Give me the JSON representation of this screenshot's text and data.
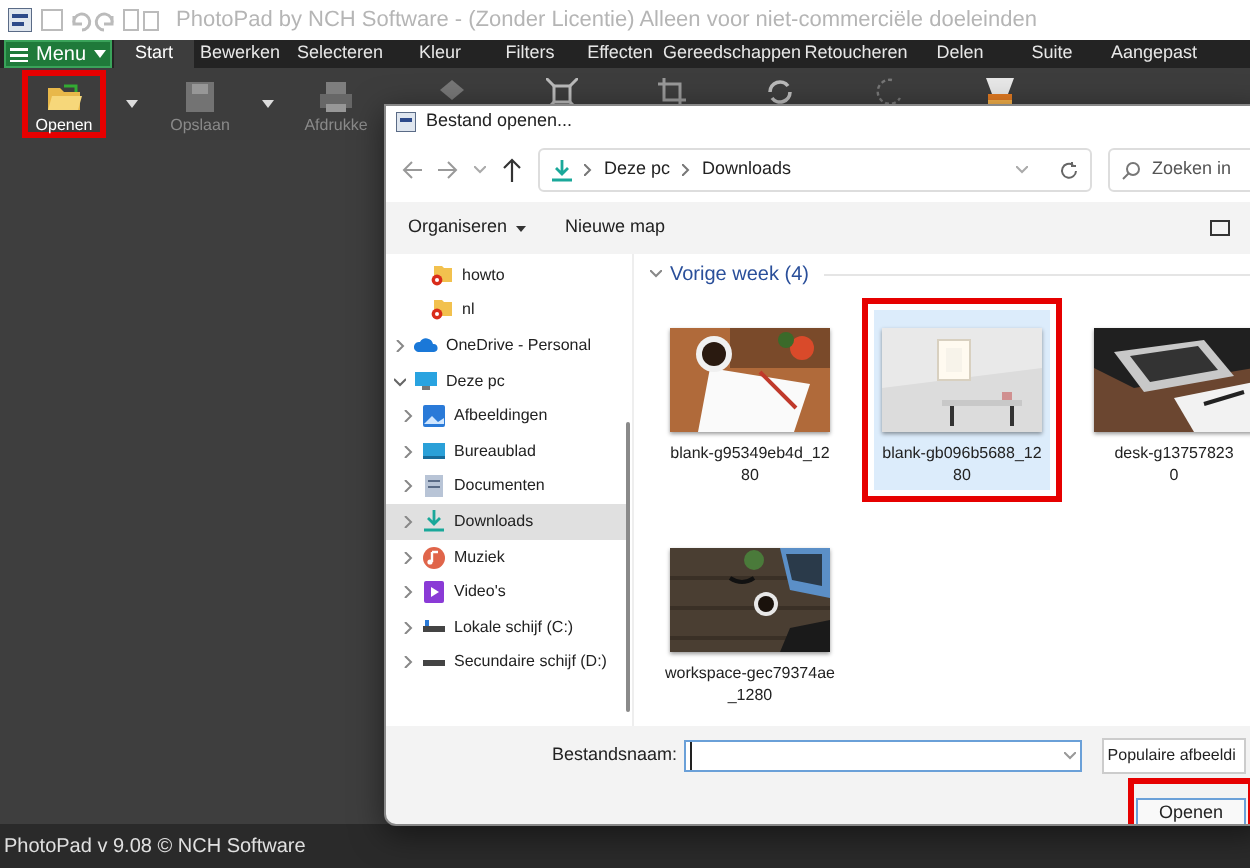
{
  "window": {
    "title": "PhotoPad by NCH Software - (Zonder Licentie) Alleen voor niet-commerciële doeleinden"
  },
  "menu_button": {
    "label": "Menu"
  },
  "tabs": [
    {
      "label": "Start",
      "selected": true
    },
    {
      "label": "Bewerken",
      "selected": false
    },
    {
      "label": "Selecteren",
      "selected": false
    },
    {
      "label": "Kleur",
      "selected": false
    },
    {
      "label": "Filters",
      "selected": false
    },
    {
      "label": "Effecten",
      "selected": false
    },
    {
      "label": "Gereedschappen",
      "selected": false
    },
    {
      "label": "Retoucheren",
      "selected": false
    },
    {
      "label": "Delen",
      "selected": false
    },
    {
      "label": "Suite",
      "selected": false
    },
    {
      "label": "Aangepast",
      "selected": false
    }
  ],
  "toolbar": [
    {
      "kind": "button",
      "label": "Openen",
      "disabled": false,
      "highlighted": true
    },
    {
      "kind": "caret"
    },
    {
      "kind": "button",
      "label": "Opslaan",
      "disabled": true,
      "highlighted": false
    },
    {
      "kind": "caret"
    },
    {
      "kind": "button",
      "label": "Afdrukke",
      "disabled": true,
      "highlighted": false
    }
  ],
  "dialog": {
    "title": "Bestand openen...",
    "path": [
      "Deze pc",
      "Downloads"
    ],
    "search": {
      "placeholder": "Zoeken in"
    },
    "commands": [
      {
        "label": "Organiseren",
        "dropdown": true
      },
      {
        "label": "Nieuwe map",
        "dropdown": false
      }
    ],
    "nav": [
      {
        "label": "howto",
        "selected": false
      },
      {
        "label": "nl",
        "selected": false
      },
      {
        "label": "OneDrive - Personal",
        "selected": false,
        "expanded": false
      },
      {
        "label": "Deze pc",
        "selected": false,
        "expanded": true,
        "children": [
          {
            "label": "Afbeeldingen",
            "selected": false,
            "expanded": false
          },
          {
            "label": "Bureaublad",
            "selected": false,
            "expanded": false
          },
          {
            "label": "Documenten",
            "selected": false,
            "expanded": false
          },
          {
            "label": "Downloads",
            "selected": true,
            "expanded": false
          },
          {
            "label": "Muziek",
            "selected": false,
            "expanded": false
          },
          {
            "label": "Video's",
            "selected": false,
            "expanded": false
          },
          {
            "label": "Lokale schijf (C:)",
            "selected": false,
            "expanded": false
          },
          {
            "label": "Secundaire schijf (D:)",
            "selected": false,
            "expanded": false
          }
        ]
      }
    ],
    "group": {
      "label": "Vorige week (4)",
      "expanded": true
    },
    "files": [
      {
        "name_lines": [
          "blank-g95349eb4d_12",
          "80"
        ],
        "selected": false,
        "highlighted": false
      },
      {
        "name_lines": [
          "blank-gb096b5688_12",
          "80"
        ],
        "selected": true,
        "highlighted": true
      },
      {
        "name_lines": [
          "desk-g13757823",
          "0"
        ],
        "selected": false,
        "highlighted": false
      },
      {
        "name_lines": [
          "workspace-gec79374ae",
          "_1280"
        ],
        "selected": false,
        "highlighted": false
      }
    ],
    "filename": {
      "label": "Bestandsnaam:"
    },
    "filter": {
      "value": "Populaire afbeeldi"
    },
    "open_button": {
      "label": "Openen",
      "highlighted": true
    }
  },
  "status_bar": {
    "text": "PhotoPad v 9.08 © NCH Software"
  }
}
